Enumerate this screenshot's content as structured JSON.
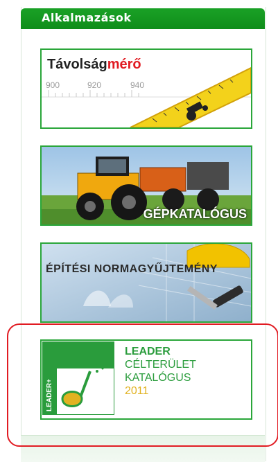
{
  "section": {
    "title": "Alkalmazások"
  },
  "banners": [
    {
      "title_part1": "Távolság",
      "title_part2": "mérő",
      "tick1": "900",
      "tick2": "920",
      "tick3": "940"
    },
    {
      "label": "GÉPKATALÓGUS"
    },
    {
      "label": "ÉPÍTÉSI NORMAGYŰJTEMÉNY"
    },
    {
      "line1": "LEADER",
      "line2": "CÉLTERÜLET",
      "line3": "KATALÓGUS",
      "line4": "2011",
      "vertical": "LEADER+"
    }
  ],
  "colors": {
    "header": "#14991f",
    "border": "#2aa63a",
    "highlight": "#e11b22",
    "leader_green": "#2a9c3c",
    "year_yellow": "#e1b221"
  }
}
